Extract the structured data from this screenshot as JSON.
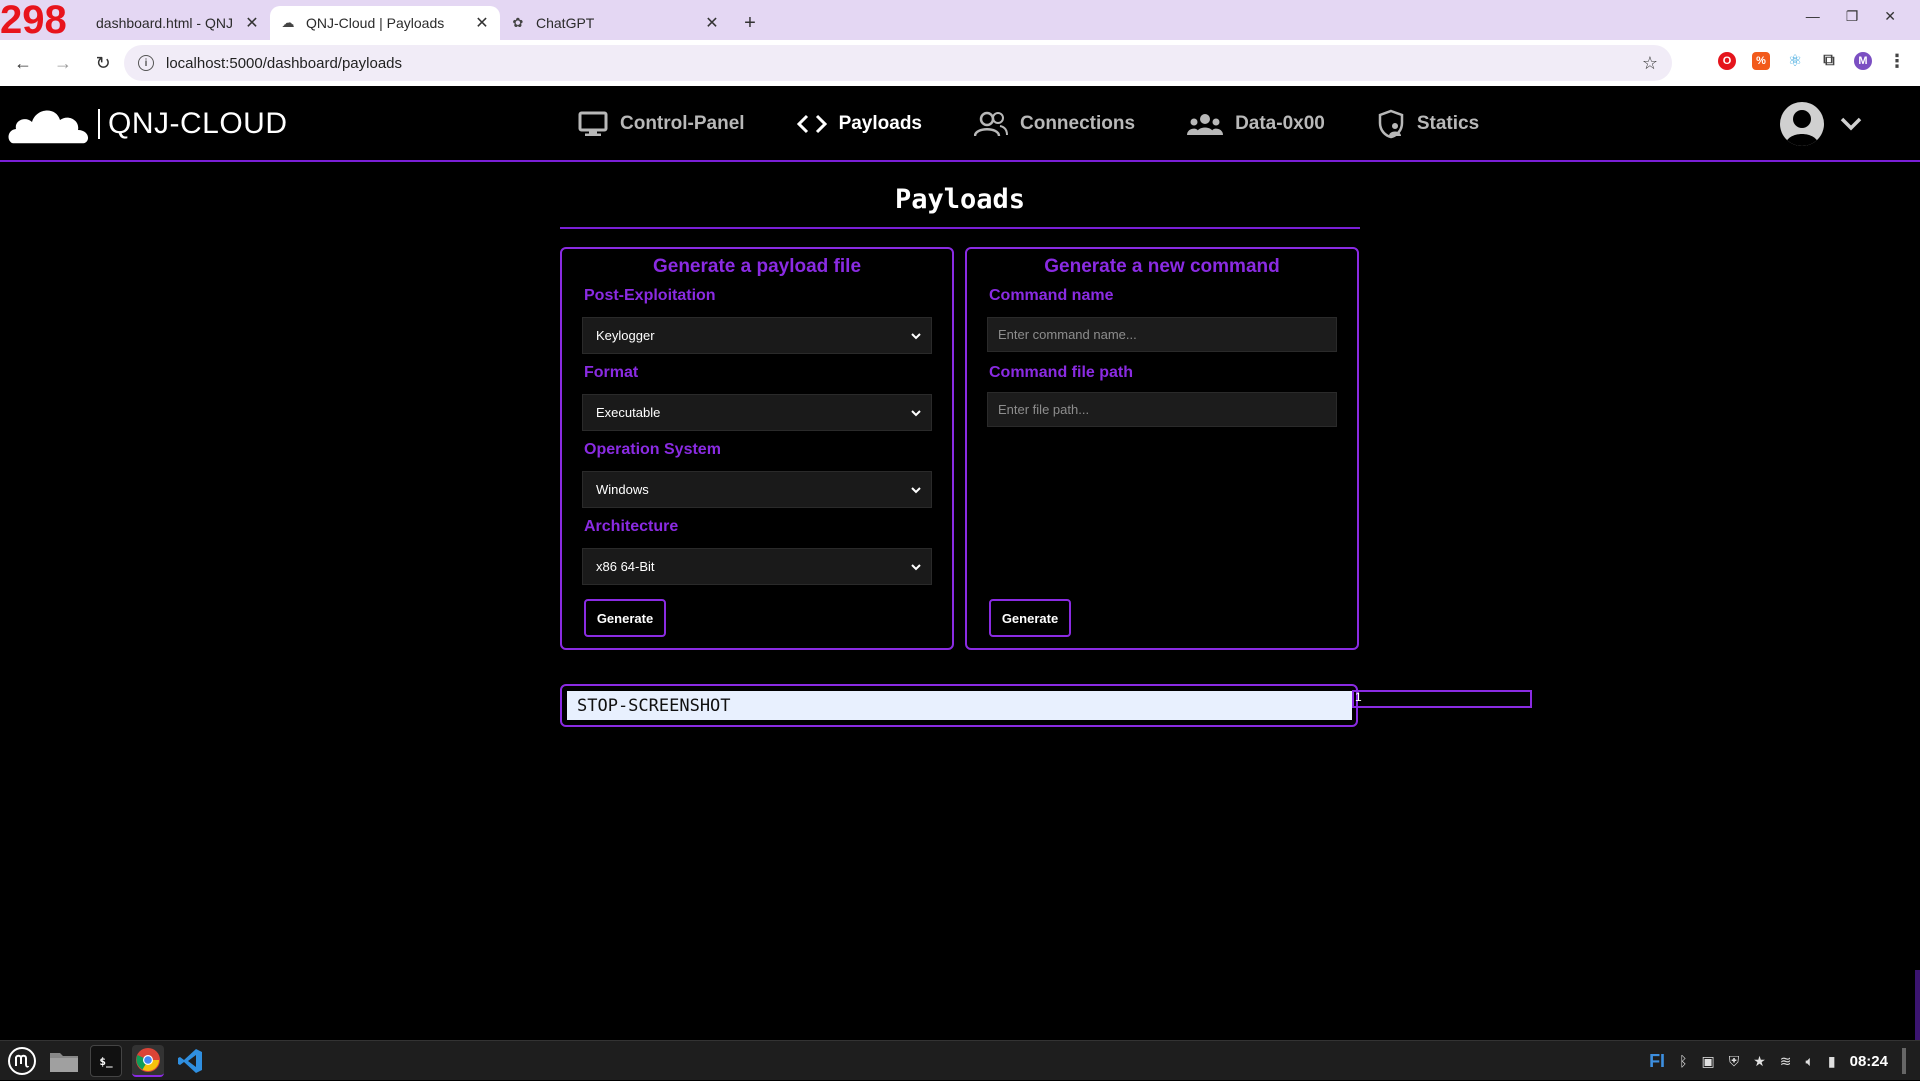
{
  "browser": {
    "tab_counter": "298",
    "tabs": [
      {
        "title": "dashboard.html - QNJ - code",
        "active": false
      },
      {
        "title": "QNJ-Cloud | Payloads",
        "active": true
      },
      {
        "title": "ChatGPT",
        "active": false
      }
    ],
    "url": "localhost:5000/dashboard/payloads",
    "profile_initial": "M"
  },
  "header": {
    "logo_text": "QNJ-CLOUD",
    "nav": [
      {
        "label": "Control-Panel",
        "icon": "monitor-icon",
        "active": false
      },
      {
        "label": "Payloads",
        "icon": "code-icon",
        "active": true
      },
      {
        "label": "Connections",
        "icon": "users-icon",
        "active": false
      },
      {
        "label": "Data-0x00",
        "icon": "group-icon",
        "active": false
      },
      {
        "label": "Statics",
        "icon": "shield-user-icon",
        "active": false
      }
    ]
  },
  "page": {
    "title": "Payloads",
    "payload_card": {
      "title": "Generate a payload file",
      "fields": [
        {
          "label": "Post-Exploitation",
          "value": "Keylogger"
        },
        {
          "label": "Format",
          "value": "Executable"
        },
        {
          "label": "Operation System",
          "value": "Windows"
        },
        {
          "label": "Architecture",
          "value": "x86 64-Bit"
        }
      ],
      "button_label": "Generate"
    },
    "command_card": {
      "title": "Generate a new command",
      "name_label": "Command name",
      "name_placeholder": "Enter command name...",
      "path_label": "Command file path",
      "path_placeholder": "Enter file path...",
      "button_label": "Generate"
    },
    "output_text": "STOP-SCREENSHOT",
    "floating_input_value": "1"
  },
  "taskbar": {
    "keyboard_layout": "FI",
    "time": "08:24"
  },
  "colors": {
    "accent": "#8a2be2",
    "background": "#000000",
    "tabbar": "#e4d7f3"
  }
}
